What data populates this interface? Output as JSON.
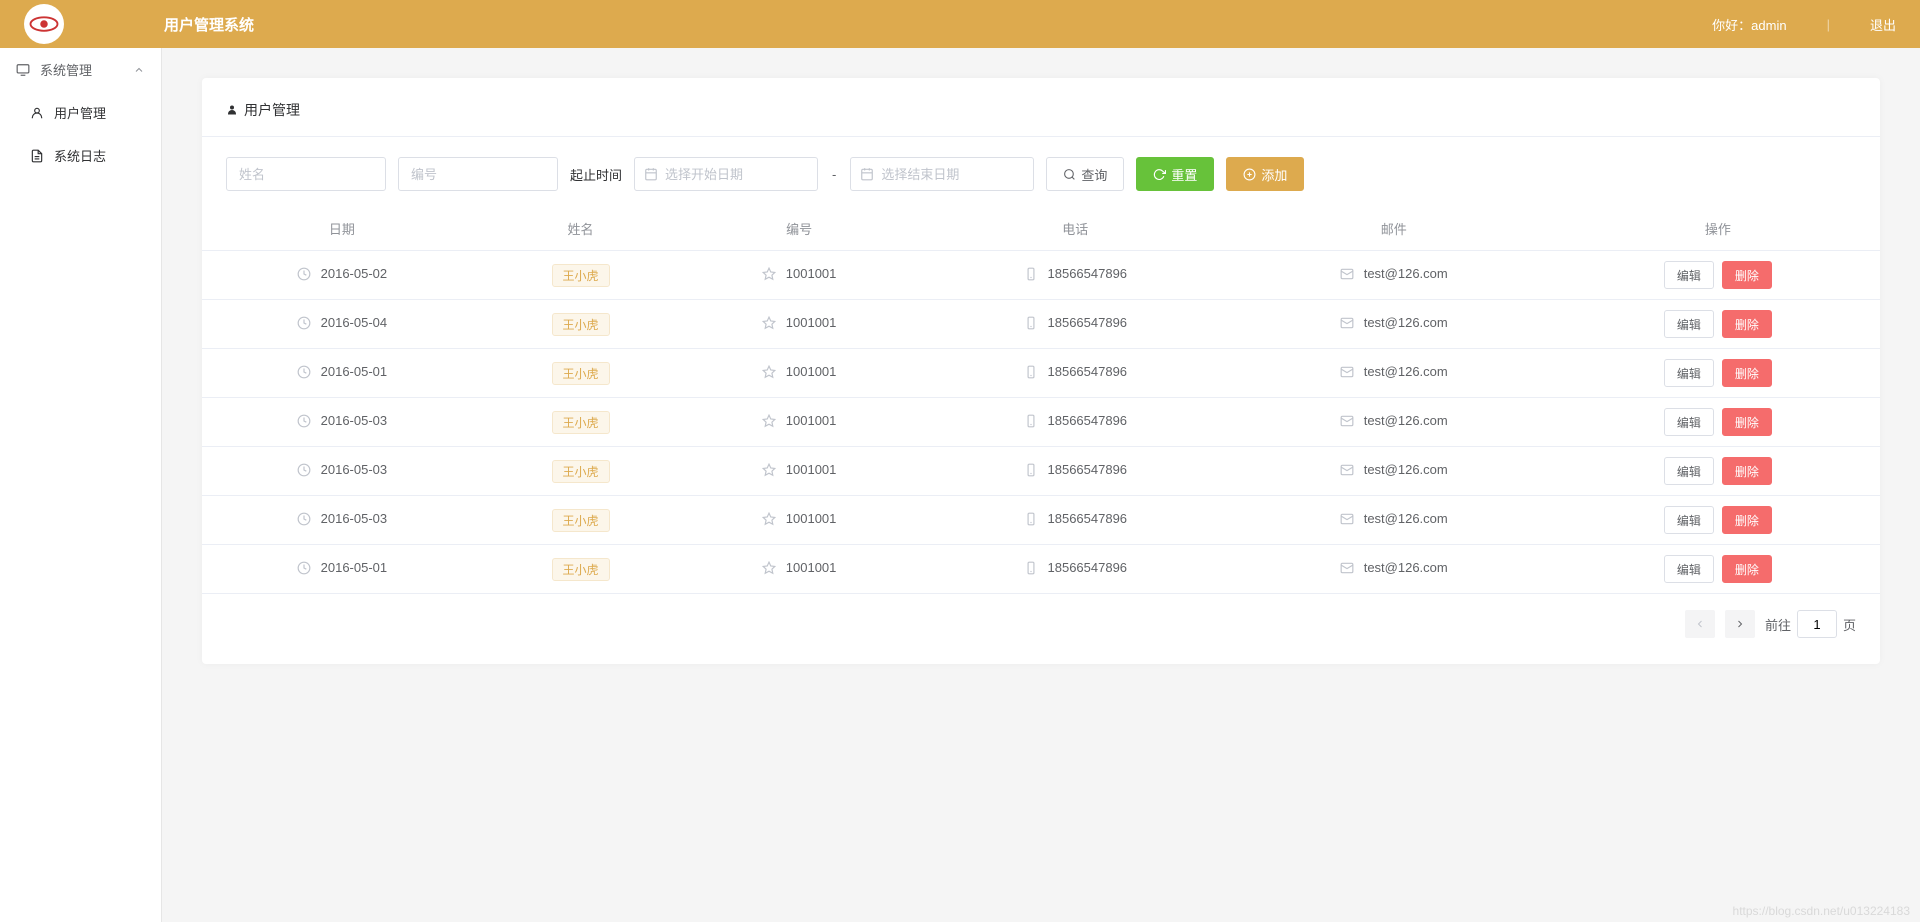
{
  "header": {
    "brand": "用户管理系统",
    "greeting_prefix": "你好：",
    "username": "admin",
    "logout": "退出"
  },
  "sidebar": {
    "group": "系统管理",
    "items": [
      {
        "label": "用户管理",
        "active": false
      },
      {
        "label": "系统日志",
        "active": false
      }
    ]
  },
  "panel": {
    "title": "用户管理"
  },
  "filters": {
    "name_placeholder": "姓名",
    "code_placeholder": "编号",
    "date_label": "起止时间",
    "start_placeholder": "选择开始日期",
    "end_placeholder": "选择结束日期",
    "dash": "-",
    "query": "查询",
    "reset": "重置",
    "add": "添加"
  },
  "table": {
    "headers": [
      "日期",
      "姓名",
      "编号",
      "电话",
      "邮件",
      "操作"
    ],
    "edit_label": "编辑",
    "delete_label": "删除",
    "rows": [
      {
        "date": "2016-05-02",
        "name": "王小虎",
        "code": "1001001",
        "phone": "18566547896",
        "email": "test@126.com"
      },
      {
        "date": "2016-05-04",
        "name": "王小虎",
        "code": "1001001",
        "phone": "18566547896",
        "email": "test@126.com"
      },
      {
        "date": "2016-05-01",
        "name": "王小虎",
        "code": "1001001",
        "phone": "18566547896",
        "email": "test@126.com"
      },
      {
        "date": "2016-05-03",
        "name": "王小虎",
        "code": "1001001",
        "phone": "18566547896",
        "email": "test@126.com"
      },
      {
        "date": "2016-05-03",
        "name": "王小虎",
        "code": "1001001",
        "phone": "18566547896",
        "email": "test@126.com"
      },
      {
        "date": "2016-05-03",
        "name": "王小虎",
        "code": "1001001",
        "phone": "18566547896",
        "email": "test@126.com"
      },
      {
        "date": "2016-05-01",
        "name": "王小虎",
        "code": "1001001",
        "phone": "18566547896",
        "email": "test@126.com"
      }
    ]
  },
  "pagination": {
    "goto_prefix": "前往",
    "goto_suffix": "页",
    "current": "1"
  },
  "watermark": "https://blog.csdn.net/u013224183"
}
